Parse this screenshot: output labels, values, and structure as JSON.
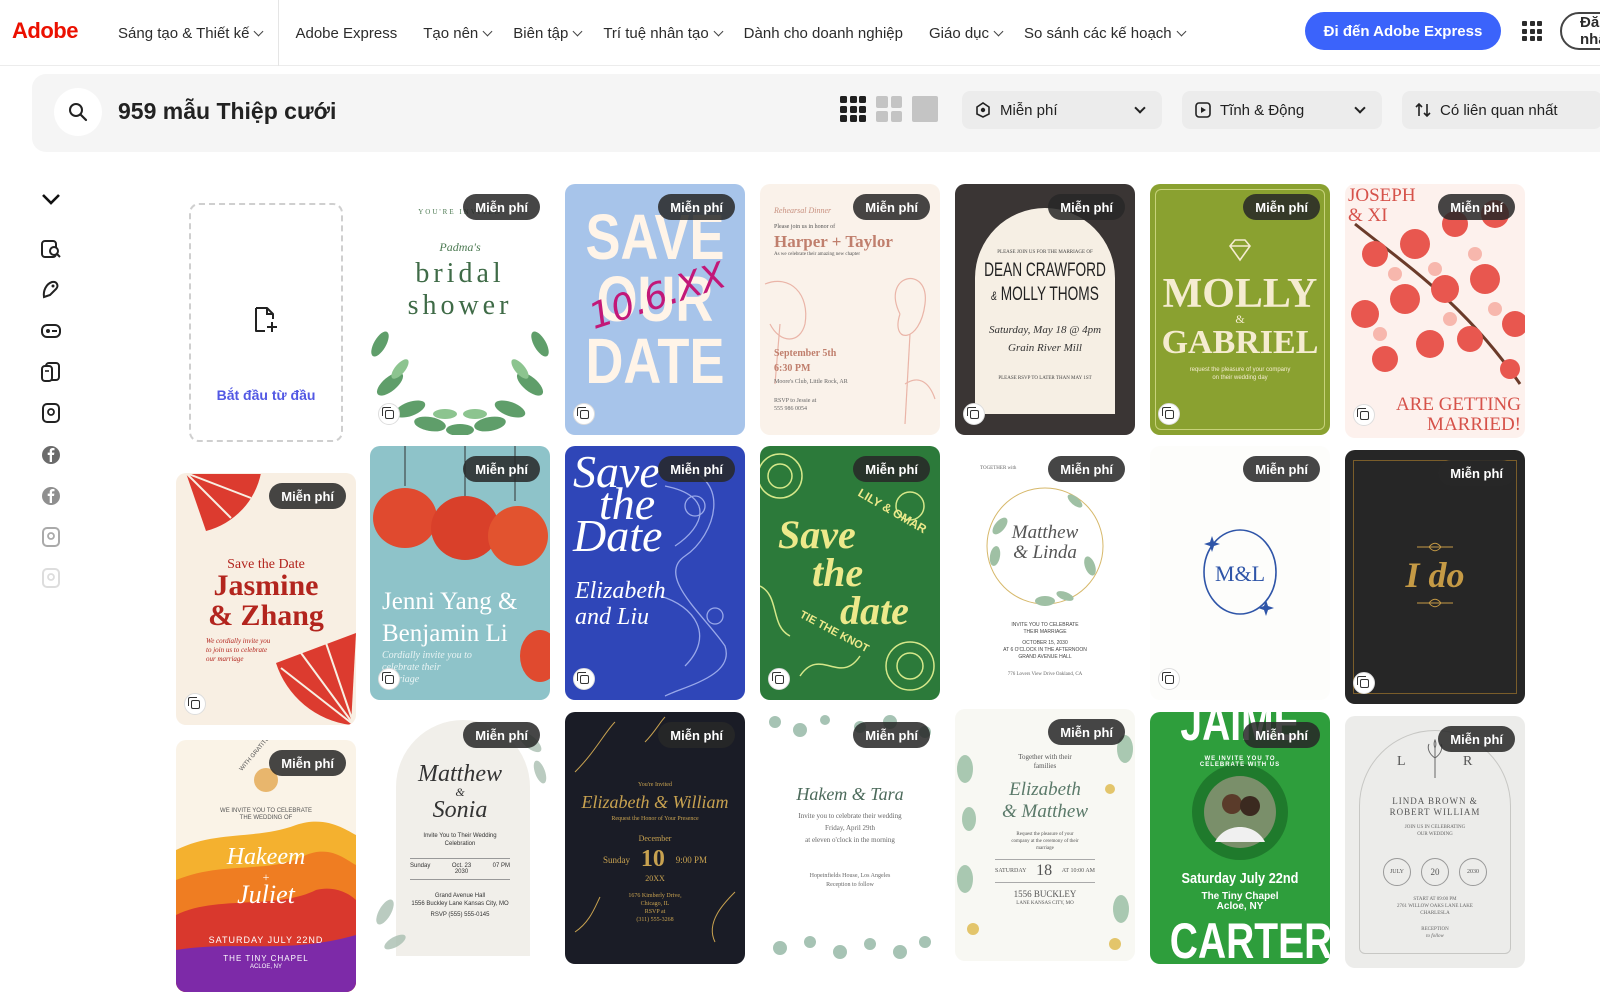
{
  "nav": {
    "logo": "Adobe",
    "items": [
      {
        "label": "Sáng tạo & Thiết kế",
        "dropdown": true
      },
      {
        "label": "Adobe Express",
        "dropdown": false
      },
      {
        "label": "Tạo nên",
        "dropdown": true
      },
      {
        "label": "Biên tập",
        "dropdown": true
      },
      {
        "label": "Trí tuệ nhân tạo",
        "dropdown": true
      },
      {
        "label": "Dành cho doanh nghiệp",
        "dropdown": false
      },
      {
        "label": "Giáo dục",
        "dropdown": true
      },
      {
        "label": "So sánh các kế hoạch",
        "dropdown": true
      }
    ],
    "cta": "Đi đến Adobe Express",
    "signin": "Đăng nhập",
    "apps_icon": "apps-grid-icon"
  },
  "search": {
    "result_text": "959 mẫu Thiệp cưới",
    "filters": {
      "price": "Miễn phí",
      "motion": "Tĩnh & Động",
      "sort": "Có liên quan nhất"
    }
  },
  "sidebar": {
    "collapse_icon": "chevron-down-icon",
    "icons": [
      "template-search-icon",
      "brush-icon",
      "badge-icon",
      "catalog-icon",
      "document-icon",
      "facebook-icon",
      "facebook-icon",
      "doc-faded-icon",
      "doc-faded-icon"
    ]
  },
  "blank": {
    "label": "Bắt đầu từ đầu"
  },
  "badge_text": "Miễn phí",
  "templates": [
    {
      "id": "bridal",
      "bg": "#ffffff",
      "lines": [
        "YOU'RE INVITED",
        "Padma's",
        "bridal",
        "shower"
      ]
    },
    {
      "id": "save-our-date",
      "bg": "#a7c4ea",
      "lines": [
        "SAVE",
        "OUR",
        "DATE",
        "10.6.XX"
      ]
    },
    {
      "id": "harper",
      "bg": "#faf2ea",
      "lines": [
        "Rehearsal Dinner",
        "Please join us in honor of",
        "Harper + Taylor",
        "As we celebrate their amazing new chapter",
        "September 5th",
        "6:30 PM",
        "Moore's Club, Little Rock, AR",
        "RSVP to Jessie at",
        "555 986 0054"
      ]
    },
    {
      "id": "dean",
      "bg": "#3a3534",
      "lines": [
        "PLEASE JOIN US FOR THE MARRIAGE OF",
        "DEAN CRAWFORD",
        "&",
        "MOLLY THOMS",
        "Saturday, May 18 @ 4pm",
        "Grain River Mill",
        "PLEASE RSVP TO LATER THAN MAY 1ST"
      ]
    },
    {
      "id": "molly",
      "bg": "#8aa130",
      "lines": [
        "MOLLY",
        "&",
        "GABRIEL",
        "request the pleasure of your company",
        "on their wedding day"
      ]
    },
    {
      "id": "joseph",
      "bg": "#fdf1ed",
      "lines": [
        "JOSEPH",
        "& XI",
        "ARE GETTING",
        "MARRIED!"
      ]
    },
    {
      "id": "jasmine",
      "bg": "#f8efe3",
      "lines": [
        "Save the Date",
        "Jasmine",
        "& Zhang",
        "We cordially invite you",
        "to join us to celebrate",
        "our marriage"
      ]
    },
    {
      "id": "jenni",
      "bg": "#8ec3c9",
      "lines": [
        "Jenni Yang &",
        "Benjamin Li",
        "Cordially invite you to",
        "celebrate their",
        "marriage"
      ]
    },
    {
      "id": "save-blue",
      "bg": "#2f46b8",
      "lines": [
        "Save",
        "the",
        "Date",
        "Elizabeth",
        "and",
        "Liu"
      ]
    },
    {
      "id": "lily",
      "bg": "#2c7a3a",
      "lines": [
        "LILY & OMAR",
        "Save",
        "the",
        "date",
        "TIE THE KNOT"
      ]
    },
    {
      "id": "matthew-linda",
      "bg": "#ffffff",
      "lines": [
        "TOGETHER with",
        "Matthew",
        "& Linda",
        "INVITE YOU TO CELEBRATE",
        "THEIR MARRIAGE",
        "OCTOBER 15, 2030",
        "AT 6 O'CLOCK IN THE AFTERNOON",
        "GRAND AVENUE HALL",
        "776 Lovers View Drive Oakland, CA"
      ]
    },
    {
      "id": "ml",
      "bg": "#ffffff",
      "lines": [
        "M&L"
      ]
    },
    {
      "id": "ido",
      "bg": "#262626",
      "lines": [
        "I do"
      ]
    },
    {
      "id": "hakeem",
      "bg": "#faf3e7",
      "lines": [
        "WITH GRATITUDE",
        "WE INVITE YOU TO CELEBRATE",
        "THE WEDDING OF",
        "Hakeem",
        "+",
        "Juliet",
        "SATURDAY JULY 22ND",
        "THE TINY CHAPEL",
        "ACLOE, NY"
      ]
    },
    {
      "id": "matthew-sonia",
      "bg": "#ffffff",
      "lines": [
        "Matthew",
        "&",
        "Sonia",
        "Invite You to Their Wedding",
        "Celebration",
        "Sunday",
        "Oct. 23",
        "2030",
        "07 PM",
        "Grand Avenue Hall",
        "1556 Buckley Lane Kansas City, MO",
        "RSVP (555) 555-0145"
      ]
    },
    {
      "id": "elizabeth-william",
      "bg": "#1a1c26",
      "lines": [
        "You're Invited",
        "Elizabeth & William",
        "Request the Honor of Your Presence",
        "December",
        "Sunday",
        "10",
        "9:00 PM",
        "20XX",
        "1676 Kimberly Drive,",
        "Chicago, IL",
        "RSVP at",
        "(311) 555-3268"
      ]
    },
    {
      "id": "hakem-tara",
      "bg": "#ffffff",
      "lines": [
        "Hakem & Tara",
        "Invite you to celebrate their wedding",
        "Friday, April 29th",
        "at eleven o'clock in the morning",
        "Hopeinfields House, Los Angeles",
        "Reception to follow"
      ]
    },
    {
      "id": "elizabeth-matthew",
      "bg": "#f8f8f3",
      "lines": [
        "Together with their",
        "families",
        "Elizabeth",
        "& Matthew",
        "Request the pleasure of your",
        "company at the ceremony of their",
        "marriage",
        "SATURDAY",
        "18",
        "AT 10:00 AM",
        "1556 BUCKLEY",
        "LANE KANSAS CITY, MO"
      ]
    },
    {
      "id": "jaime",
      "bg": "#2e9e3c",
      "lines": [
        "JAIME",
        "WE INVITE YOU TO CELEBRATE WITH US",
        "Saturday July 22nd",
        "The Tiny Chapel",
        "Acloe, NY",
        "CARTER"
      ]
    },
    {
      "id": "linda-robert",
      "bg": "#ececea",
      "lines": [
        "L",
        "R",
        "LINDA BROWN &",
        "ROBERT WILLIAM",
        "JOIN US IN CELEBRATING",
        "OUR WEDDING",
        "JULY",
        "20",
        "2030",
        "START AT 09:00 PM",
        "2761 WILLOW OAKS LANE LAKE",
        "CHARLESLA",
        "RECEPTION",
        "to follow"
      ]
    }
  ]
}
